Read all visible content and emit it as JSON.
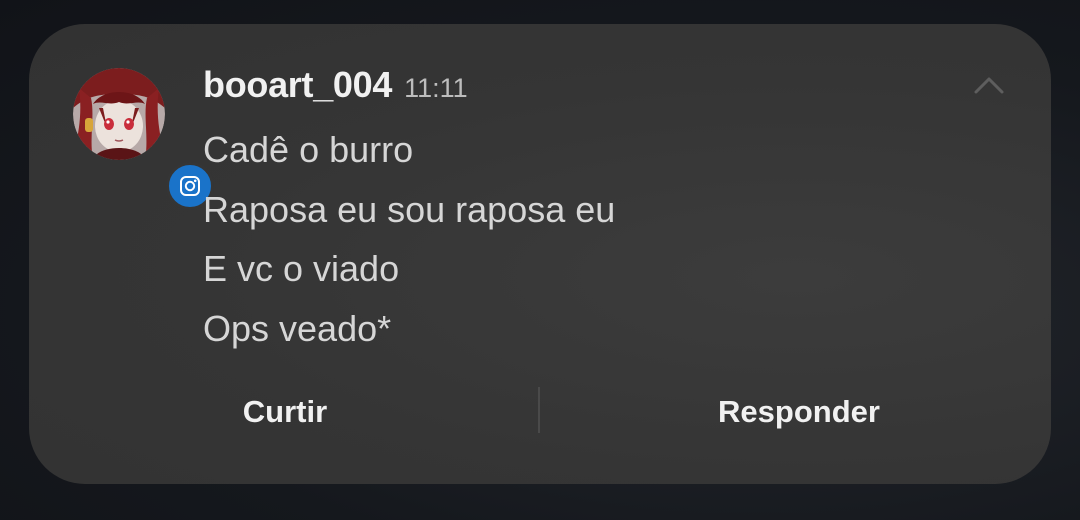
{
  "notification": {
    "sender": "booart_004",
    "time": "11:11",
    "app_icon": "instagram-icon",
    "messages": [
      "Cadê o burro",
      "Raposa eu sou raposa eu",
      "E vc o viado",
      "Ops veado*"
    ],
    "actions": {
      "like_label": "Curtir",
      "reply_label": "Responder"
    },
    "colors": {
      "card_background": "#353535",
      "badge_blue": "#1a73c9",
      "text_primary": "#f1f1f1",
      "text_secondary": "#d6d6d6"
    }
  }
}
